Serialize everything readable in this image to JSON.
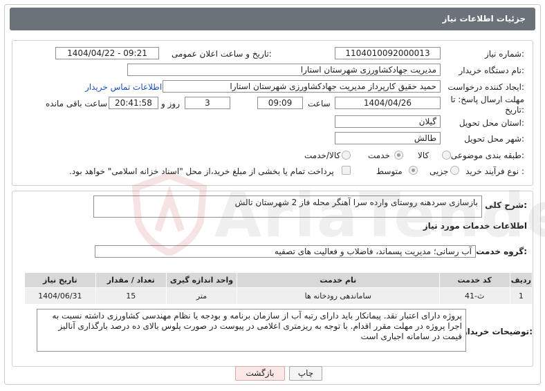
{
  "header": {
    "title": "جزئیات اطلاعات نیاز"
  },
  "form": {
    "need_number_label": "شماره نیاز:",
    "need_number": "1104010092000013",
    "announce_label": "تاریخ و ساعت اعلان عمومی:",
    "announce_value": "1404/04/22 - 09:21",
    "buyer_org_label": "نام دستگاه خریدار:",
    "buyer_org": "مدیریت جهادکشاورزی شهرستان استارا",
    "creator_label": "ایجاد کننده درخواست:",
    "creator": "حمید حقیق کارپرداز مدیریت جهادکشاورزی شهرستان استارا",
    "contact_link": "اطلاعات تماس خریدار",
    "deadline_label_1": "مهلت ارسال پاسخ: تا",
    "deadline_label_2": "تاریخ:",
    "deadline_date": "1404/04/26",
    "time_label": "ساعت",
    "deadline_time": "09:09",
    "days_value": "3",
    "days_label": "روز و",
    "remaining_time": "20:41:58",
    "remaining_label": "ساعت باقی مانده",
    "province_label": "استان محل تحویل:",
    "province": "گیلان",
    "city_label": "شهر محل تحویل:",
    "city": "طالش",
    "category_label": "طبقه بندی موضوعی:",
    "category_options": [
      "کالا",
      "خدمت",
      "کالا/خدمت"
    ],
    "category_selected": "خدمت",
    "process_label": "نوع فرآیند خرید :",
    "process_options": [
      "جزیی",
      "متوسط"
    ],
    "process_selected": "متوسط",
    "treasury_note": "پرداخت تمام یا بخشی از مبلغ خرید،از محل \"اسناد خزانه اسلامی\" خواهد بود."
  },
  "summary": {
    "label": "شرح کلی نیاز:",
    "text": "بازسازی سردهنه روستای وارده سرا آهنگر محله فاز 2 شهرستان تالش"
  },
  "services": {
    "section_title": "اطلاعات خدمات مورد نیاز",
    "group_label": "گروه خدمت:",
    "group_value": "آب رسانی؛ مدیریت پسماند، فاضلاب و فعالیت های تصفیه",
    "columns": [
      "ردیف",
      "کد خدمت",
      "نام خدمت",
      "واحد اندازه گیری",
      "تعداد / مقدار",
      "تاریخ نیاز"
    ],
    "rows": [
      [
        "1",
        "ث-41",
        "ساماندهی رودخانه ها",
        "متر",
        "15",
        "1404/06/31"
      ]
    ]
  },
  "buyer_notes": {
    "label": "توضیحات خریدار:",
    "text": "پروژه دارای اعتبار نقد. پیمانکار باید دارای رتبه آب از سازمان برنامه و بودجه یا نظام مهندسی کشاورزی داشته نسبت به اجرا پروژه در مهلت مقرر اقدام. با توجه به ریزمتری اعلامی در پیوست در صورت پلوس بالای ده درصد بارگذاری آنالیز قیمت در سامانه اجباری است"
  },
  "buttons": {
    "print": "چاپ",
    "back": "بازگشت"
  },
  "watermark": {
    "text": "AriaTender.net"
  },
  "colors": {
    "header_bg": "#6b727a",
    "link": "#1a52b8",
    "back_button_bg": "#fde8e8"
  }
}
